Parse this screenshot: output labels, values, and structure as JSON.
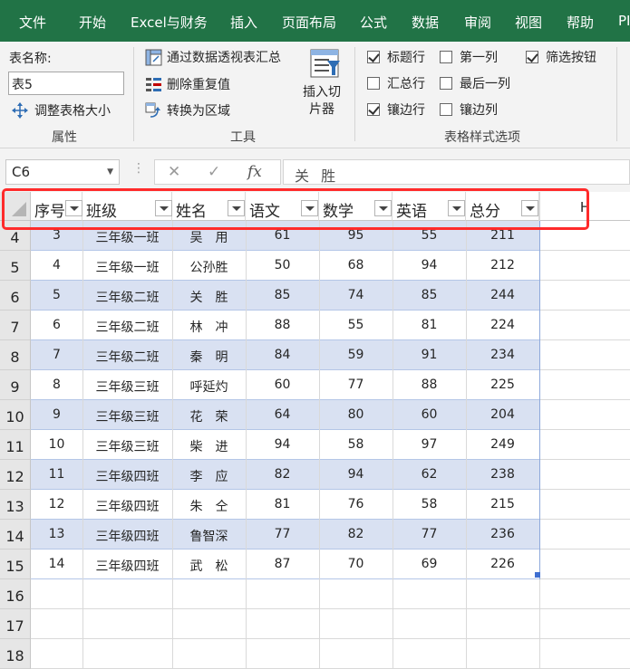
{
  "menu": [
    "文件",
    "开始",
    "Excel与财务",
    "插入",
    "页面布局",
    "公式",
    "数据",
    "审阅",
    "视图",
    "帮助",
    "PI"
  ],
  "ribbon": {
    "properties": {
      "table_name_label": "表名称:",
      "table_name_value": "表5",
      "resize_label": "调整表格大小",
      "group_label": "属性"
    },
    "tools": {
      "pivot_label": "通过数据透视表汇总",
      "remove_dup_label": "删除重复值",
      "convert_label": "转换为区域",
      "slicer_label": "插入切片器",
      "group_label": "工具"
    },
    "style_options": {
      "group_label": "表格样式选项",
      "options": [
        {
          "label": "标题行",
          "checked": true
        },
        {
          "label": "汇总行",
          "checked": false
        },
        {
          "label": "镶边行",
          "checked": true
        },
        {
          "label": "第一列",
          "checked": false
        },
        {
          "label": "最后一列",
          "checked": false
        },
        {
          "label": "镶边列",
          "checked": false
        },
        {
          "label": "筛选按钮",
          "checked": true
        }
      ]
    }
  },
  "formula_bar": {
    "name_box": "C6",
    "cancel_symbol": "✕",
    "enter_symbol": "✓",
    "fx_symbol": "fx",
    "content": "关 胜"
  },
  "table": {
    "headers": [
      "序号",
      "班级",
      "姓名",
      "语文",
      "数学",
      "英语",
      "总分"
    ],
    "extra_column_header": "H",
    "rows": [
      {
        "row": "4",
        "cells": [
          "3",
          "三年级一班",
          "吴　用",
          "61",
          "95",
          "55",
          "211"
        ]
      },
      {
        "row": "5",
        "cells": [
          "4",
          "三年级一班",
          "公孙胜",
          "50",
          "68",
          "94",
          "212"
        ]
      },
      {
        "row": "6",
        "cells": [
          "5",
          "三年级二班",
          "关　胜",
          "85",
          "74",
          "85",
          "244"
        ]
      },
      {
        "row": "7",
        "cells": [
          "6",
          "三年级二班",
          "林　冲",
          "88",
          "55",
          "81",
          "224"
        ]
      },
      {
        "row": "8",
        "cells": [
          "7",
          "三年级二班",
          "秦　明",
          "84",
          "59",
          "91",
          "234"
        ]
      },
      {
        "row": "9",
        "cells": [
          "8",
          "三年级三班",
          "呼延灼",
          "60",
          "77",
          "88",
          "225"
        ]
      },
      {
        "row": "10",
        "cells": [
          "9",
          "三年级三班",
          "花　荣",
          "64",
          "80",
          "60",
          "204"
        ]
      },
      {
        "row": "11",
        "cells": [
          "10",
          "三年级三班",
          "柴　进",
          "94",
          "58",
          "97",
          "249"
        ]
      },
      {
        "row": "12",
        "cells": [
          "11",
          "三年级四班",
          "李　应",
          "82",
          "94",
          "62",
          "238"
        ]
      },
      {
        "row": "13",
        "cells": [
          "12",
          "三年级四班",
          "朱　仝",
          "81",
          "76",
          "58",
          "215"
        ]
      },
      {
        "row": "14",
        "cells": [
          "13",
          "三年级四班",
          "鲁智深",
          "77",
          "82",
          "77",
          "236"
        ]
      },
      {
        "row": "15",
        "cells": [
          "14",
          "三年级四班",
          "武　松",
          "87",
          "70",
          "69",
          "226"
        ]
      }
    ],
    "empty_rows": [
      "16",
      "17",
      "18"
    ]
  },
  "colors": {
    "menu_bg": "#217346",
    "band_row": "#d9e1f2",
    "highlight": "#ff2b2b"
  }
}
